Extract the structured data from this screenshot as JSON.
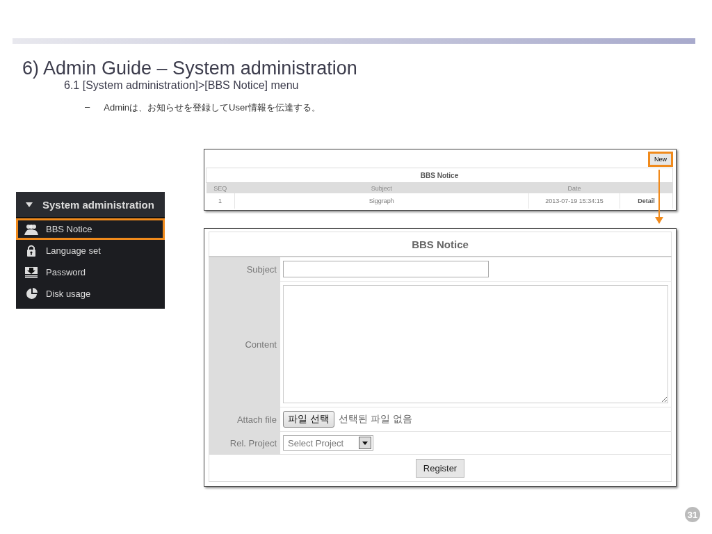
{
  "title": "6) Admin Guide – System administration",
  "subtitle": "6.1 [System administration]>[BBS Notice] menu",
  "bullet": {
    "mark": "–",
    "text": "Adminは、お知らせを登録してUser情報を伝達する。"
  },
  "sidebar": {
    "header": "System administration",
    "items": [
      {
        "label": "BBS Notice",
        "selected": true
      },
      {
        "label": "Language set",
        "selected": false
      },
      {
        "label": "Password",
        "selected": false
      },
      {
        "label": "Disk usage",
        "selected": false
      }
    ]
  },
  "list": {
    "new_button": {
      "label": "New",
      "highlighted": true
    },
    "title": "BBS Notice",
    "columns": [
      "SEQ",
      "Subject",
      "Date"
    ],
    "rows": [
      {
        "cells": [
          "1",
          "Siggraph",
          "2013-07-19 15:34:15"
        ],
        "action": "Detail"
      }
    ]
  },
  "form": {
    "title": "BBS Notice",
    "fields": [
      {
        "kind": "text",
        "label": "Subject"
      },
      {
        "kind": "textarea",
        "label": "Content"
      },
      {
        "kind": "file",
        "label": "Attach file",
        "button": "파일 선택",
        "status": "선택된 파일 없음"
      },
      {
        "kind": "select",
        "label": "Rel. Project",
        "value": "Select Project"
      }
    ],
    "submit": "Register"
  },
  "page_number": "31"
}
